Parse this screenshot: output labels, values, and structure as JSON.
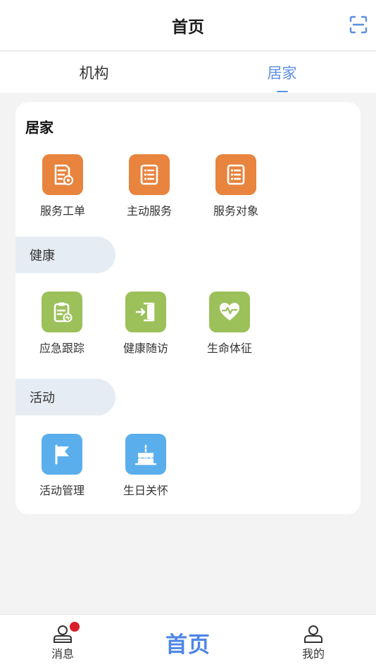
{
  "header": {
    "title": "首页",
    "scan_icon": "scan-icon"
  },
  "tabs": [
    {
      "label": "机构",
      "active": false
    },
    {
      "label": "居家",
      "active": true
    }
  ],
  "card": {
    "title": "居家",
    "home_items": [
      {
        "label": "服务工单",
        "icon": "document-settings-icon",
        "color": "#e8843e"
      },
      {
        "label": "主动服务",
        "icon": "list-document-icon",
        "color": "#e8843e"
      },
      {
        "label": "服务对象",
        "icon": "list-document-icon",
        "color": "#e8843e"
      }
    ],
    "health": {
      "label": "健康",
      "items": [
        {
          "label": "应急跟踪",
          "icon": "clipboard-pulse-icon",
          "color": "#9cc05a"
        },
        {
          "label": "健康随访",
          "icon": "door-enter-icon",
          "color": "#9cc05a"
        },
        {
          "label": "生命体征",
          "icon": "heart-pulse-icon",
          "color": "#9cc05a"
        }
      ]
    },
    "activity": {
      "label": "活动",
      "items": [
        {
          "label": "活动管理",
          "icon": "flag-icon",
          "color": "#5aaeec"
        },
        {
          "label": "生日关怀",
          "icon": "birthday-cake-icon",
          "color": "#5aaeec"
        }
      ]
    }
  },
  "bottom_nav": [
    {
      "label": "消息",
      "icon": "user-message-icon",
      "badge": true
    },
    {
      "label": "首页",
      "icon": "home-text-logo",
      "active": true
    },
    {
      "label": "我的",
      "icon": "user-profile-icon"
    }
  ],
  "colors": {
    "accent": "#5b8ee3",
    "orange": "#e8843e",
    "green": "#9cc05a",
    "blue": "#5aaeec",
    "badge": "#d81e2a"
  }
}
